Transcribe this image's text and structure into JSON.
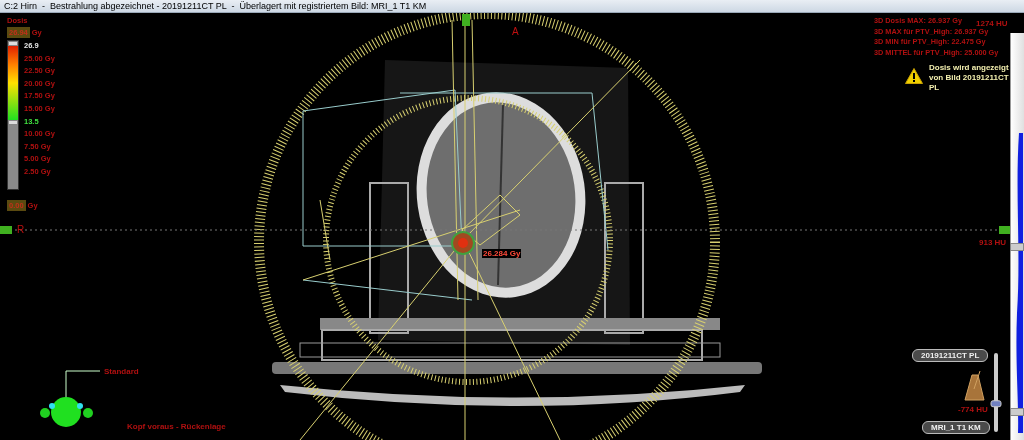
{
  "window": {
    "title": "C:2 Hirn  -  Bestrahlung abgezeichnet - 20191211CT PL  -  Überlagert mit registriertem Bild: MRI_1 T1 KM"
  },
  "dose_legend": {
    "title": "Dosis",
    "max_value": "26.94",
    "max_unit": "Gy",
    "min_value": "0.00",
    "min_unit": "Gy",
    "scale_labels": [
      {
        "kind": "upper_threshold",
        "text": "26.9"
      },
      {
        "kind": "tick",
        "text": "25.00 Gy"
      },
      {
        "kind": "tick",
        "text": "22.50 Gy"
      },
      {
        "kind": "tick",
        "text": "20.00 Gy"
      },
      {
        "kind": "tick",
        "text": "17.50 Gy"
      },
      {
        "kind": "tick",
        "text": "15.00 Gy"
      },
      {
        "kind": "lower_threshold",
        "text": "13.5"
      },
      {
        "kind": "tick",
        "text": "10.00 Gy"
      },
      {
        "kind": "tick",
        "text": "7.50 Gy"
      },
      {
        "kind": "tick",
        "text": "5.00 Gy"
      },
      {
        "kind": "tick",
        "text": "2.50 Gy"
      }
    ]
  },
  "orientation_markers": [
    "A",
    "R"
  ],
  "dose_statistics": [
    "3D Dosis MAX: 26.937 Gy",
    "3D MAX für PTV_High: 26.937 Gy",
    "3D MIN für PTV_High: 22.475 Gy",
    "3D MITTEL für PTV_High: 25.000 Gy"
  ],
  "hu_readings": [
    "1274 HU",
    "913 HU",
    "-774 HU"
  ],
  "warning": {
    "text": "Dosis wird angezeigt von Bild 20191211CT PL"
  },
  "point_dose": "26.284 Gy",
  "patient_orientation": {
    "label": "Standard",
    "position": "Kopf voraus - Rückenlage"
  },
  "image_buttons": [
    {
      "label": "20191211CT PL"
    },
    {
      "label": "MRI_1 T1 KM"
    }
  ],
  "image_blend": {
    "level": 0.35
  }
}
